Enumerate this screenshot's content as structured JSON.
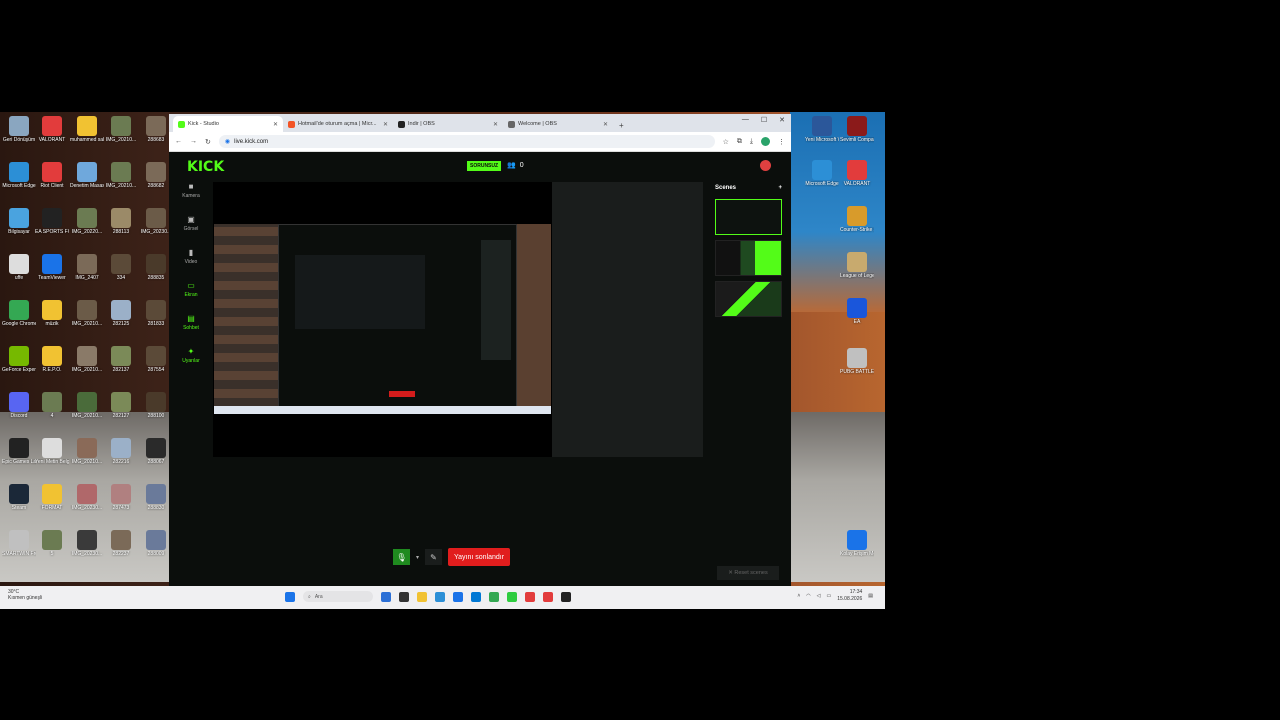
{
  "desktop": {
    "left_icons": [
      {
        "label": "Geri Dönüşüm",
        "color": "#8aa6c0"
      },
      {
        "label": "VALORANT",
        "color": "#e23c3c"
      },
      {
        "label": "muhammed sabiha",
        "color": "#f1c232"
      },
      {
        "label": "IMG_20210...",
        "color": "#6b7b52"
      },
      {
        "label": "288683",
        "color": "#7b6a58"
      },
      {
        "label": "Microsoft Edge",
        "color": "#2c8fd6"
      },
      {
        "label": "Riot Client",
        "color": "#e23c3c"
      },
      {
        "label": "Denetim Masası",
        "color": "#6fa8dc"
      },
      {
        "label": "IMG_20210...",
        "color": "#6b7b52"
      },
      {
        "label": "288682",
        "color": "#7b6a58"
      },
      {
        "label": "Bilgisayar",
        "color": "#4aa3df"
      },
      {
        "label": "EA SPORTS FC 26",
        "color": "#222"
      },
      {
        "label": "IMG_20220...",
        "color": "#6b7b52"
      },
      {
        "label": "288113",
        "color": "#9b8a68"
      },
      {
        "label": "IMG_20230...",
        "color": "#6b5b48"
      },
      {
        "label": "uffe",
        "color": "#ddd"
      },
      {
        "label": "TeamViewer",
        "color": "#1a73e8"
      },
      {
        "label": "IMG_2407",
        "color": "#7b6a58"
      },
      {
        "label": "334",
        "color": "#5b4a38"
      },
      {
        "label": "288835",
        "color": "#4a3a2a"
      },
      {
        "label": "Google Chrome",
        "color": "#34a853"
      },
      {
        "label": "müzik",
        "color": "#f1c232"
      },
      {
        "label": "IMG_20210...",
        "color": "#6b5b48"
      },
      {
        "label": "282125",
        "color": "#9bb0c8"
      },
      {
        "label": "281833",
        "color": "#5b4a38"
      },
      {
        "label": "GeForce Experience",
        "color": "#76b900"
      },
      {
        "label": "R.E.P.O.",
        "color": "#f1c232"
      },
      {
        "label": "IMG_20210...",
        "color": "#8a7a68"
      },
      {
        "label": "282137",
        "color": "#7b8a58"
      },
      {
        "label": "287554",
        "color": "#5b4a38"
      },
      {
        "label": "Discord",
        "color": "#5865f2"
      },
      {
        "label": "4",
        "color": "#6b7b52"
      },
      {
        "label": "IMG_20210...",
        "color": "#4a6b3a"
      },
      {
        "label": "282127",
        "color": "#7b8a58"
      },
      {
        "label": "288100",
        "color": "#4a3a2a"
      },
      {
        "label": "Epic Games Launcher",
        "color": "#222"
      },
      {
        "label": "Yeni Metin Belgesi",
        "color": "#ddd"
      },
      {
        "label": "IMG_20210...",
        "color": "#8a6a58"
      },
      {
        "label": "282216",
        "color": "#9bb0c8"
      },
      {
        "label": "288067",
        "color": "#2a2a2a"
      },
      {
        "label": "Steam",
        "color": "#1b2838"
      },
      {
        "label": "FORMAT",
        "color": "#f1c232"
      },
      {
        "label": "IMG_20230...",
        "color": "#b0686a"
      },
      {
        "label": "287473",
        "color": "#b08080"
      },
      {
        "label": "288830",
        "color": "#6a7a9a"
      },
      {
        "label": "SMARTWIN Free",
        "color": "#c0c0c0"
      },
      {
        "label": "5",
        "color": "#6b7b52"
      },
      {
        "label": "IMG_20230...",
        "color": "#3a3a3a"
      },
      {
        "label": "282237",
        "color": "#7b6a58"
      },
      {
        "label": "288009",
        "color": "#6a7a9a"
      }
    ],
    "right_icons": [
      {
        "label": "Yeni Microsoft Wo...",
        "color": "#2b579a"
      },
      {
        "label": "Sevimli Company",
        "color": "#8b1a1a"
      },
      {
        "label": "Microsoft Edge",
        "color": "#2c8fd6"
      },
      {
        "label": "VALORANT",
        "color": "#e23c3c"
      },
      {
        "label": "Counter-Strike 2",
        "color": "#d89b2b"
      },
      {
        "label": "League of Legends",
        "color": "#c8aa6e"
      },
      {
        "label": "EA",
        "color": "#1a56db"
      },
      {
        "label": "PUBG BATTLEGR...",
        "color": "#c0c0c0"
      },
      {
        "label": "Kolay Erişim Merkezi",
        "color": "#1a73e8"
      }
    ]
  },
  "browser": {
    "tabs": [
      {
        "title": "Kick - Studio",
        "fav": "#53fc18",
        "active": true
      },
      {
        "title": "Hotmail'de oturum açma | Micr...",
        "fav": "#f35325",
        "active": false
      },
      {
        "title": "İndir | OBS",
        "fav": "#222",
        "active": false
      },
      {
        "title": "Welcome | OBS",
        "fav": "#666",
        "active": false
      }
    ],
    "url": "live.kick.com"
  },
  "kick": {
    "logo": "KICK",
    "status_badge": "SORUNSUZ",
    "viewers": "0",
    "nav": [
      {
        "label": "Kamera",
        "icon": "■",
        "hl": false
      },
      {
        "label": "Görsel",
        "icon": "▣",
        "hl": false
      },
      {
        "label": "Video",
        "icon": "▮",
        "hl": false
      },
      {
        "label": "Ekran",
        "icon": "▭",
        "hl": true
      },
      {
        "label": "Sohbet",
        "icon": "▤",
        "hl": true
      },
      {
        "label": "Uyarılar",
        "icon": "✦",
        "hl": true
      }
    ],
    "scenes_title": "Scenes",
    "scenes_add": "+",
    "end_stream": "Yayını sonlandır",
    "reset_scenes": "✕ Reset scenes"
  },
  "taskbar": {
    "weather_temp": "30°C",
    "weather_desc": "Kısmen güneşli",
    "search": "Ara",
    "time": "17:34",
    "date": "15.08.2026",
    "icons": [
      "#2b6fd6",
      "#333",
      "#f1c232",
      "#2c8fd6",
      "#1a73e8",
      "#0078d4",
      "#34a853",
      "#2ecc40",
      "#e23c3c",
      "#e23c3c",
      "#222"
    ]
  }
}
